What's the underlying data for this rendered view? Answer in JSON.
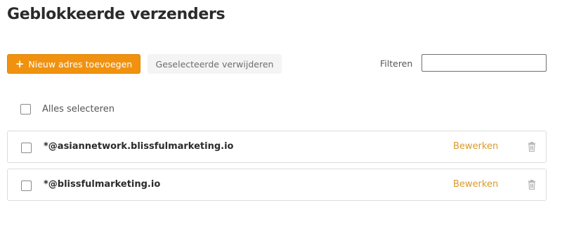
{
  "page": {
    "title": "Geblokkeerde verzenders"
  },
  "toolbar": {
    "add_label": "Nieuw adres toevoegen",
    "remove_label": "Geselecteerde verwijderen",
    "filter_label": "Filteren",
    "filter_value": ""
  },
  "list": {
    "select_all_label": "Alles selecteren",
    "items": [
      {
        "address": "*@asiannetwork.blissfulmarketing.io",
        "edit_label": "Bewerken"
      },
      {
        "address": "*@blissfulmarketing.io",
        "edit_label": "Bewerken"
      }
    ]
  },
  "colors": {
    "accent": "#f0920f",
    "link": "#d99a2b"
  }
}
